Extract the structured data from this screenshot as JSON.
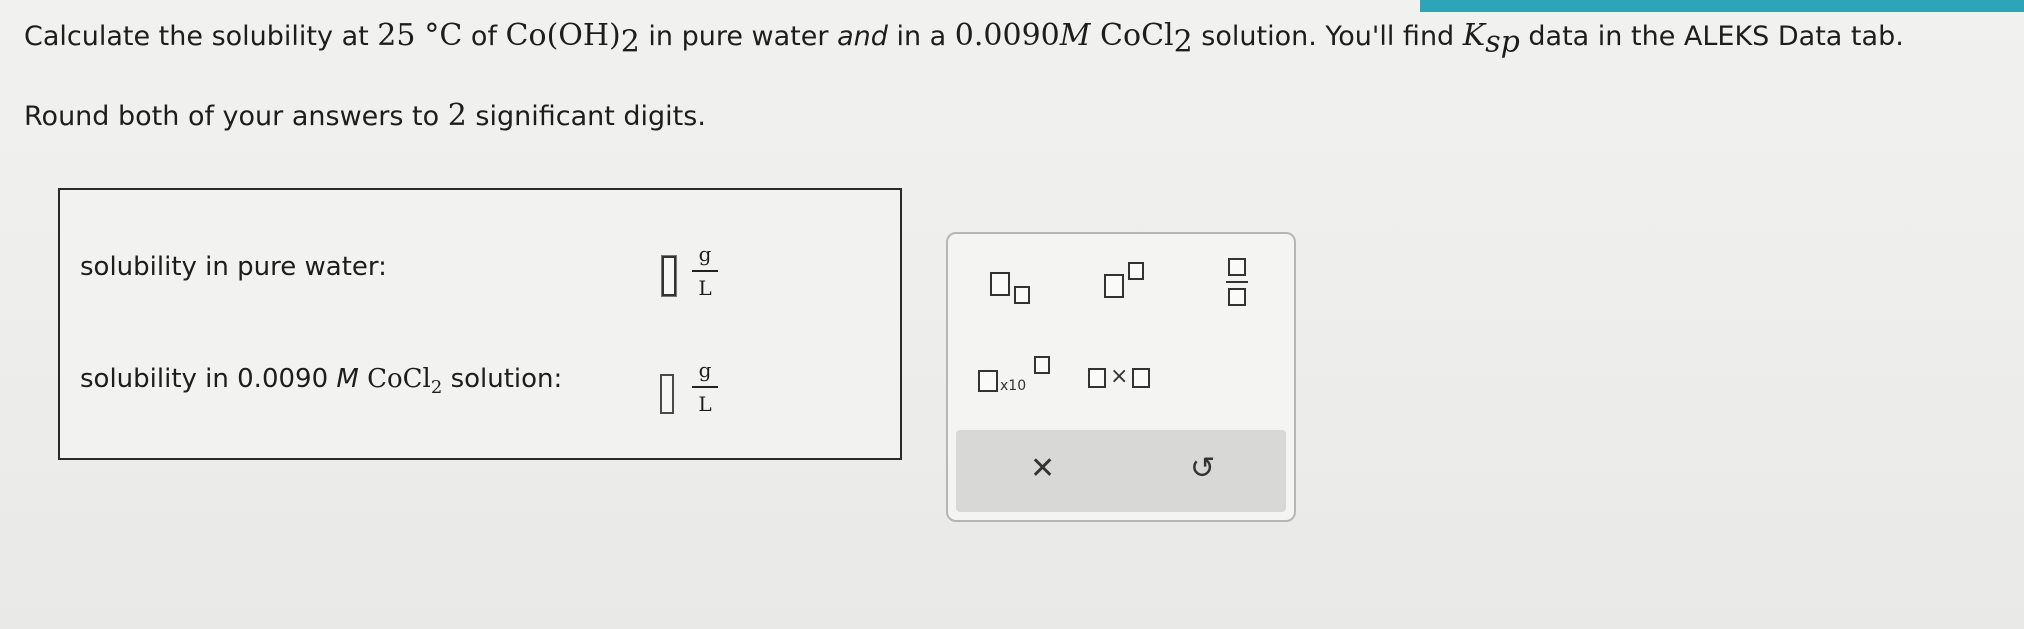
{
  "question": {
    "p1": "Calculate the solubility at ",
    "temp": "25",
    "temp_unit": "°C",
    "p2": " of ",
    "compound_main": "Co(OH)",
    "compound_sub": "2",
    "p3": " in pure water ",
    "p3_italic": "and",
    "p4": " in a ",
    "conc": "0.0090",
    "conc_unit": "M",
    "salt_main": "CoCl",
    "salt_sub": "2",
    "p5": " solution. You'll find ",
    "ksp_main": "K",
    "ksp_sub": "sp",
    "p6": " data in the ALEKS Data tab.",
    "line2_a": "Round both of your answers to ",
    "line2_num": "2",
    "line2_b": " significant digits."
  },
  "answers": {
    "row1_label": "solubility in pure water:",
    "row2_label_a": "solubility in 0.0090 ",
    "row2_label_M": "M",
    "row2_label_salt": "CoCl",
    "row2_label_sub": "2",
    "row2_label_b": " solution:",
    "unit_num": "g",
    "unit_den": "L"
  },
  "keypad": {
    "x10_label": "x10",
    "times_label": "×",
    "clear_icon": "✕",
    "reset_icon": "↺"
  },
  "colors": {
    "accent": "#2ea4b8"
  }
}
